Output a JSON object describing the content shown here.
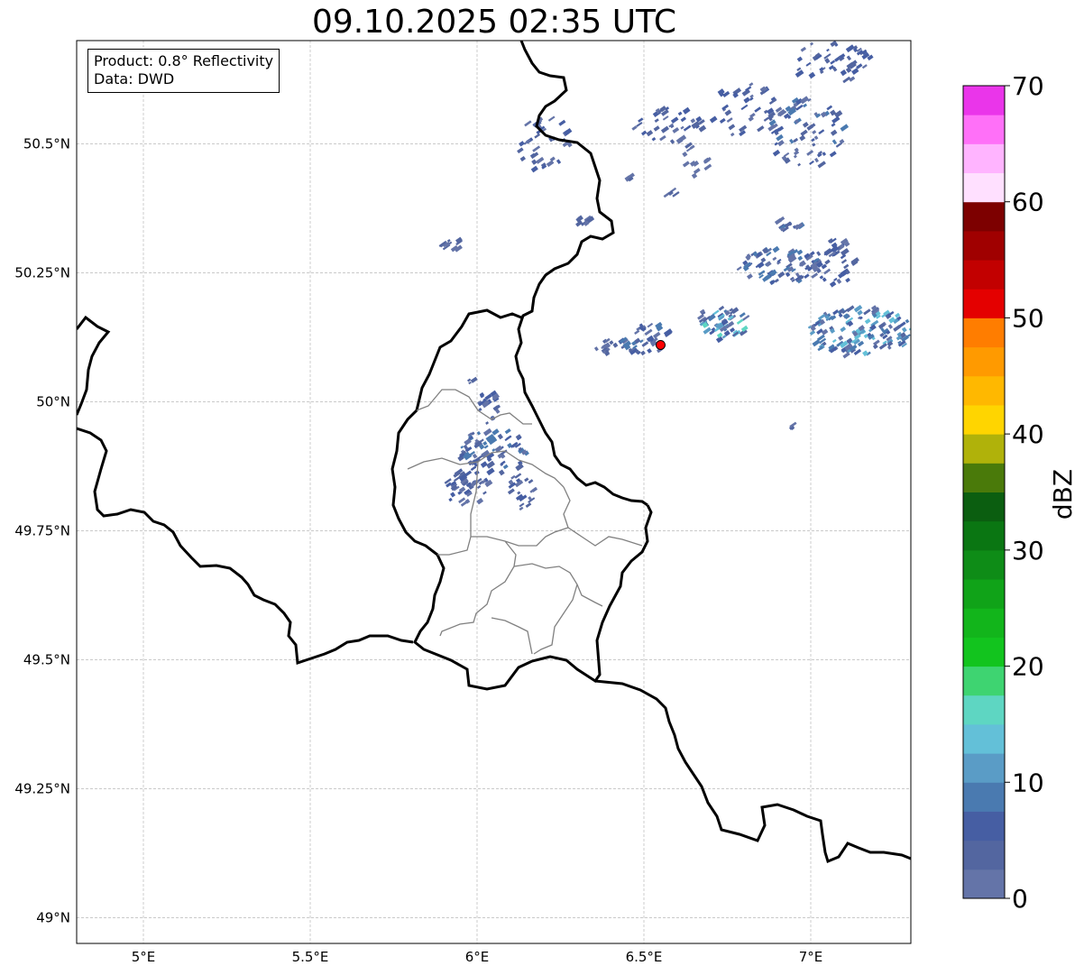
{
  "title": "09.10.2025 02:35 UTC",
  "info": {
    "product": "Product: 0.8° Reflectivity",
    "data": "Data: DWD"
  },
  "map": {
    "lon_range": [
      4.8,
      7.3
    ],
    "lat_range": [
      48.95,
      50.7
    ],
    "lon_ticks": [
      {
        "value": 5.0,
        "label": "5°E"
      },
      {
        "value": 5.5,
        "label": "5.5°E"
      },
      {
        "value": 6.0,
        "label": "6°E"
      },
      {
        "value": 6.5,
        "label": "6.5°E"
      },
      {
        "value": 7.0,
        "label": "7°E"
      }
    ],
    "lat_ticks": [
      {
        "value": 50.5,
        "label": "50.5°N"
      },
      {
        "value": 50.25,
        "label": "50.25°N"
      },
      {
        "value": 50.0,
        "label": "50°N"
      },
      {
        "value": 49.75,
        "label": "49.75°N"
      },
      {
        "value": 49.5,
        "label": "49.5°N"
      },
      {
        "value": 49.25,
        "label": "49.25°N"
      },
      {
        "value": 49.0,
        "label": "49°N"
      }
    ],
    "gridlines": true,
    "radar_site": {
      "lon": 6.55,
      "lat": 50.11,
      "color": "#ff0000"
    }
  },
  "colorbar": {
    "label": "dBZ",
    "min": 0,
    "max": 70,
    "tick_labels": [
      "0",
      "10",
      "20",
      "30",
      "40",
      "50",
      "60",
      "70"
    ],
    "colors": [
      "#6474a8",
      "#5366a0",
      "#465ea3",
      "#4a7ab0",
      "#5a9cc6",
      "#63c0d8",
      "#5ed6c2",
      "#3ed471",
      "#12c41e",
      "#12b51b",
      "#10a318",
      "#0e8c17",
      "#0a7612",
      "#0b5e10",
      "#4a7a0a",
      "#b0b20a",
      "#ffd500",
      "#ffb800",
      "#ff9a00",
      "#ff7d00",
      "#e40000",
      "#c20000",
      "#a00000",
      "#7d0000",
      "#ffe0ff",
      "#ffb4ff",
      "#ff70f8",
      "#ea35ea"
    ]
  }
}
